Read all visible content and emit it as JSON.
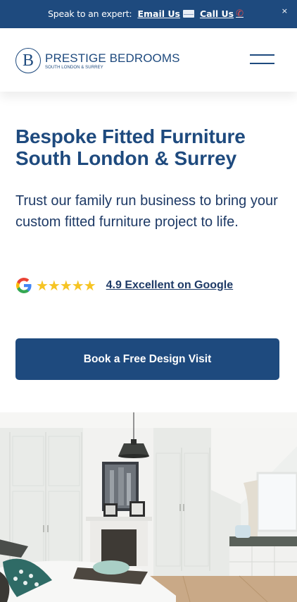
{
  "topbar": {
    "prefix": "Speak to an expert:",
    "email_label": "Email Us",
    "email_icon": "envelope-icon",
    "call_label": "Call Us",
    "call_icon": "phone-icon",
    "close_label": "×",
    "background": "#1e4a7e"
  },
  "header": {
    "logo_letter": "B",
    "brand_name": "PRESTIGE BEDROOMS",
    "brand_tagline": "SOUTH LONDON & SURREY",
    "menu_icon": "hamburger-menu-icon"
  },
  "hero": {
    "title": "Bespoke Fitted Furniture",
    "subtitle": "South London & Surrey",
    "description": "Trust our family run business to bring your custom fitted furniture project to life.",
    "rating": {
      "icon": "google-icon",
      "stars": "★★★★★",
      "star_count": 5,
      "link_label": "4.9 Excellent on Google"
    },
    "cta_label": "Book a Free Design Visit",
    "image": "fitted-bedroom-photo"
  },
  "colors": {
    "brand_navy": "#1e4a7e",
    "star_gold": "#f6c423"
  }
}
